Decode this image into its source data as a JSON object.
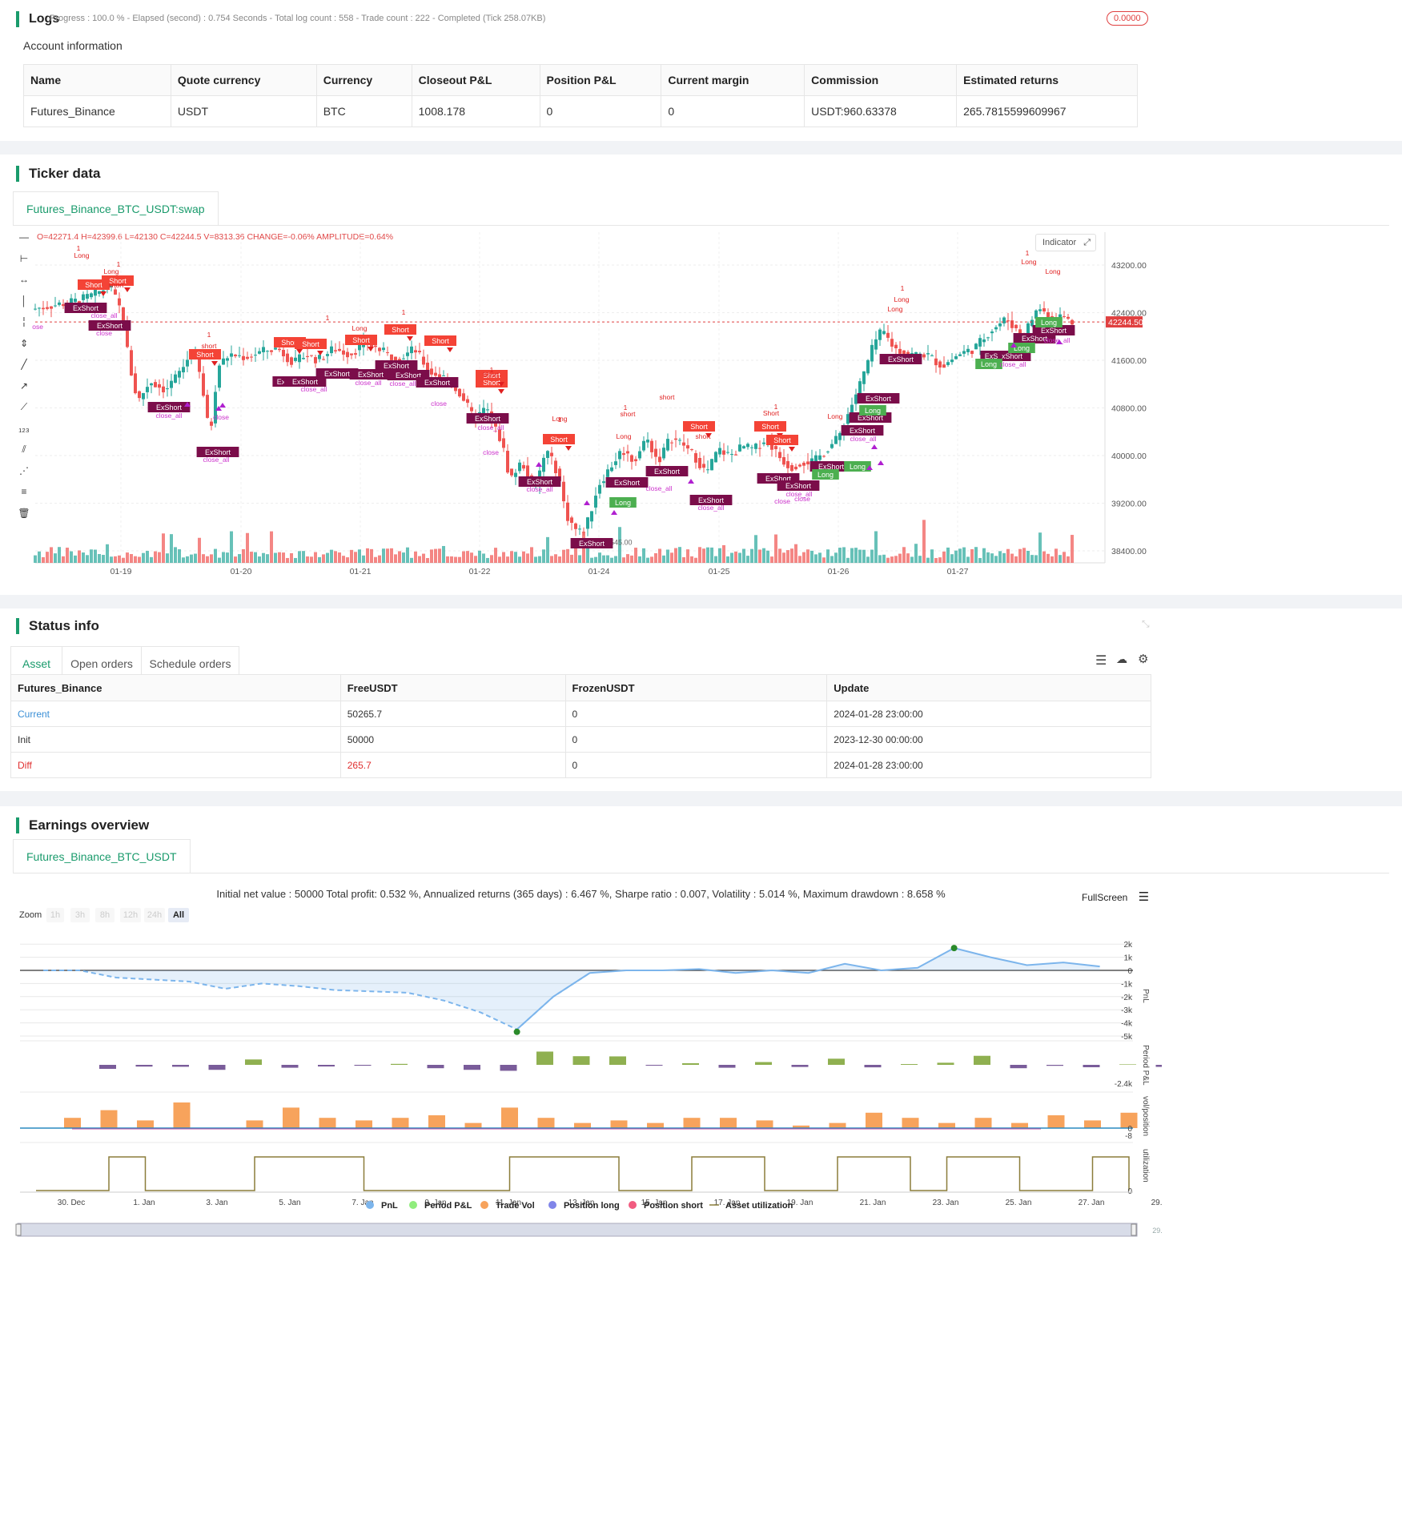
{
  "logs": {
    "title": "Logs",
    "progress": "Progress : 100.0 % - Elapsed (second) : 0.754  Seconds - Total log count : 558 - Trade count : 222 - Completed (Tick 258.07KB)",
    "badge": "0.0000"
  },
  "account": {
    "title": "Account information",
    "headers": [
      "Name",
      "Quote currency",
      "Currency",
      "Closeout P&L",
      "Position P&L",
      "Current margin",
      "Commission",
      "Estimated returns"
    ],
    "row": [
      "Futures_Binance",
      "USDT",
      "BTC",
      "1008.178",
      "0",
      "0",
      "USDT:960.63378",
      "265.7815599609967"
    ]
  },
  "ticker": {
    "title": "Ticker data",
    "tab": "Futures_Binance_BTC_USDT:swap",
    "ohlc": "O=42271.4 H=42399.6 L=42130 C=42244.5 V=8313.36 CHANGE=-0.06% AMPLITUDE=0.64%",
    "indicator_btn": "Indicator",
    "current_price": "42244.50",
    "low_label": "38545.00",
    "y_ticks": [
      "43200.00",
      "42400.00",
      "41600.00",
      "40800.00",
      "40000.00",
      "39200.00",
      "38400.00"
    ],
    "x_ticks": [
      "01-19",
      "01-20",
      "01-21",
      "01-22",
      "01-24",
      "01-25",
      "01-26",
      "01-27"
    ],
    "colors": {
      "up": "#26a69a",
      "down": "#ef5350",
      "exshort": "#7b0d4a",
      "long": "#4caf50",
      "short": "#f44336",
      "close": "#cc33cc"
    }
  },
  "status": {
    "title": "Status info",
    "tabs": [
      "Asset",
      "Open orders",
      "Schedule orders"
    ],
    "headers": [
      "Futures_Binance",
      "FreeUSDT",
      "FrozenUSDT",
      "Update"
    ],
    "rows": [
      [
        "Current",
        "50265.7",
        "0",
        "2024-01-28 23:00:00"
      ],
      [
        "Init",
        "50000",
        "0",
        "2023-12-30 00:00:00"
      ],
      [
        "Diff",
        "265.7",
        "0",
        "2024-01-28 23:00:00"
      ]
    ]
  },
  "earnings": {
    "title": "Earnings overview",
    "tab": "Futures_Binance_BTC_USDT",
    "summary": "Initial net value : 50000 Total profit: 0.532 %, Annualized returns (365 days) : 6.467 %, Sharpe ratio : 0.007, Volatility : 5.014 %, Maximum drawdown : 8.658 %",
    "fullscreen": "FullScreen",
    "zoom_label": "Zoom",
    "zoom_options": [
      "1h",
      "3h",
      "8h",
      "12h",
      "24h",
      "All"
    ],
    "pnl_ticks": [
      "2k",
      "1k",
      "0",
      "-1k",
      "-2k",
      "-3k",
      "-4k",
      "-5k"
    ],
    "axis_labels": [
      "PnL",
      "Period P&L",
      "vol/position",
      "utilization"
    ],
    "period_tick": "-2.4k",
    "vol_ticks": [
      "0",
      "-8"
    ],
    "util_tick": "0",
    "x_dates": [
      "30. Dec",
      "1. Jan",
      "3. Jan",
      "5. Jan",
      "7. Jan",
      "9. Jan",
      "11. Jan",
      "13. Jan",
      "15. Jan",
      "17. Jan",
      "19. Jan",
      "21. Jan",
      "23. Jan",
      "25. Jan",
      "27. Jan",
      "29. Jan"
    ],
    "legend": [
      "PnL",
      "Period P&L",
      "Trade Vol",
      "Position long",
      "Position short",
      "Asset utilization"
    ],
    "legend_colors": [
      "#7cb5ec",
      "#90ed7d",
      "#f7a35c",
      "#8085e9",
      "#f15c80",
      "#8b7d3a"
    ]
  },
  "chart_data": [
    {
      "type": "line",
      "title": "PnL",
      "x": [
        "30. Dec",
        "31. Dec",
        "1. Jan",
        "2. Jan",
        "3. Jan",
        "4. Jan",
        "5. Jan",
        "6. Jan",
        "7. Jan",
        "8. Jan",
        "9. Jan",
        "10. Jan",
        "11. Jan",
        "12. Jan",
        "13. Jan",
        "14. Jan",
        "15. Jan",
        "16. Jan",
        "17. Jan",
        "18. Jan",
        "19. Jan",
        "20. Jan",
        "21. Jan",
        "22. Jan",
        "23. Jan",
        "24. Jan",
        "25. Jan",
        "26. Jan",
        "27. Jan",
        "28. Jan"
      ],
      "values": [
        0,
        0,
        -550,
        -700,
        -850,
        -1400,
        -1000,
        -1200,
        -1500,
        -1600,
        -1700,
        -2300,
        -3200,
        -4500,
        -2000,
        -200,
        0,
        0,
        100,
        -200,
        0,
        -200,
        500,
        0,
        200,
        1700,
        1000,
        400,
        600,
        300
      ],
      "ylim": [
        -5000,
        2000
      ]
    },
    {
      "type": "bar",
      "title": "Period P&L",
      "values": [
        -420,
        -180,
        -200,
        -520,
        560,
        -300,
        -170,
        -90,
        100,
        -350,
        -520,
        -620,
        1380,
        900,
        880,
        0,
        170,
        -300,
        290,
        -220,
        640,
        -260,
        80,
        220,
        940,
        -350,
        -100,
        -250,
        50,
        -210
      ]
    },
    {
      "type": "bar",
      "title": "Trade Vol",
      "values": [
        4,
        7,
        3,
        10,
        0,
        3,
        8,
        4,
        3,
        4,
        5,
        2,
        8,
        4,
        2,
        3,
        2,
        4,
        4,
        3,
        1,
        2,
        6,
        4,
        2,
        4,
        2,
        5,
        3,
        6
      ]
    }
  ]
}
